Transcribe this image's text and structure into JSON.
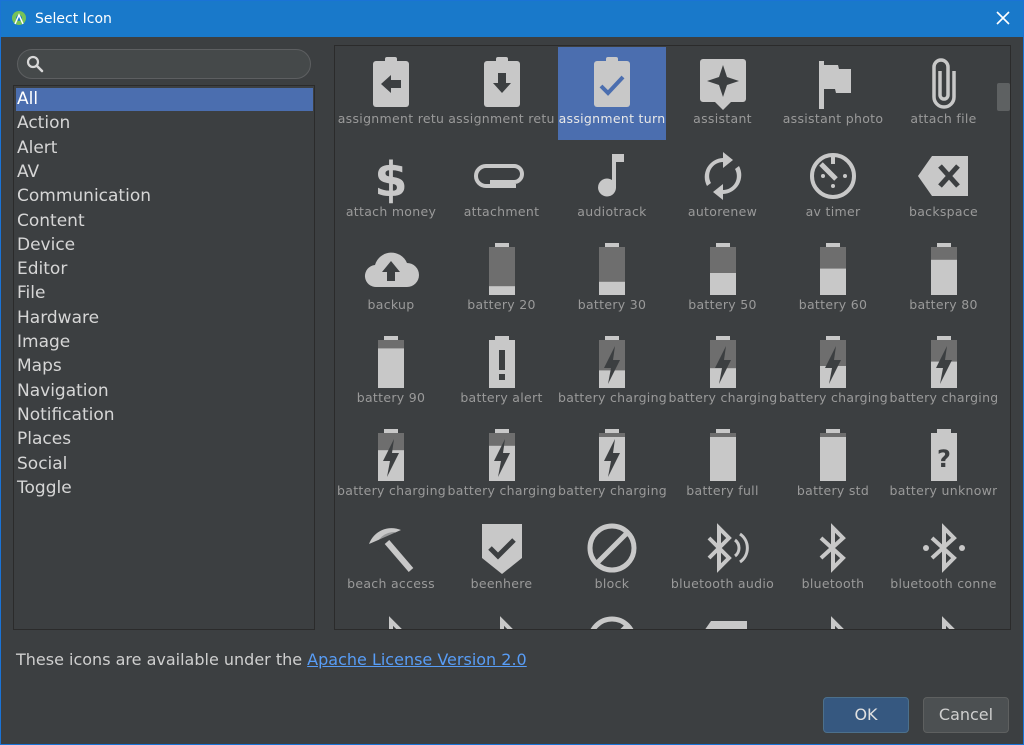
{
  "window": {
    "title": "Select Icon"
  },
  "search": {
    "placeholder": "",
    "value": ""
  },
  "categories": [
    "All",
    "Action",
    "Alert",
    "AV",
    "Communication",
    "Content",
    "Device",
    "Editor",
    "File",
    "Hardware",
    "Image",
    "Maps",
    "Navigation",
    "Notification",
    "Places",
    "Social",
    "Toggle"
  ],
  "selected_category": "All",
  "icons": [
    {
      "label": "assignment retu",
      "icon": "assignment-return-icon"
    },
    {
      "label": "assignment retu",
      "icon": "assignment-returned-icon"
    },
    {
      "label": "assignment turn",
      "icon": "assignment-turned-in-icon",
      "selected": true
    },
    {
      "label": "assistant",
      "icon": "assistant-icon"
    },
    {
      "label": "assistant photo",
      "icon": "assistant-photo-icon"
    },
    {
      "label": "attach file",
      "icon": "attach-file-icon"
    },
    {
      "label": "attach money",
      "icon": "attach-money-icon"
    },
    {
      "label": "attachment",
      "icon": "attachment-icon"
    },
    {
      "label": "audiotrack",
      "icon": "audiotrack-icon"
    },
    {
      "label": "autorenew",
      "icon": "autorenew-icon"
    },
    {
      "label": "av timer",
      "icon": "av-timer-icon"
    },
    {
      "label": "backspace",
      "icon": "backspace-icon"
    },
    {
      "label": "backup",
      "icon": "backup-icon"
    },
    {
      "label": "battery 20",
      "icon": "battery-20-icon"
    },
    {
      "label": "battery 30",
      "icon": "battery-30-icon"
    },
    {
      "label": "battery 50",
      "icon": "battery-50-icon"
    },
    {
      "label": "battery 60",
      "icon": "battery-60-icon"
    },
    {
      "label": "battery 80",
      "icon": "battery-80-icon"
    },
    {
      "label": "battery 90",
      "icon": "battery-90-icon"
    },
    {
      "label": "battery alert",
      "icon": "battery-alert-icon"
    },
    {
      "label": "battery charging",
      "icon": "battery-charging-20-icon"
    },
    {
      "label": "battery charging",
      "icon": "battery-charging-30-icon"
    },
    {
      "label": "battery charging",
      "icon": "battery-charging-50-icon"
    },
    {
      "label": "battery charging",
      "icon": "battery-charging-60-icon"
    },
    {
      "label": "battery charging",
      "icon": "battery-charging-80-icon"
    },
    {
      "label": "battery charging",
      "icon": "battery-charging-90-icon"
    },
    {
      "label": "battery charging",
      "icon": "battery-charging-full-icon"
    },
    {
      "label": "battery full",
      "icon": "battery-full-icon"
    },
    {
      "label": "battery std",
      "icon": "battery-std-icon"
    },
    {
      "label": "battery unknown",
      "icon": "battery-unknown-icon"
    },
    {
      "label": "beach access",
      "icon": "beach-access-icon"
    },
    {
      "label": "beenhere",
      "icon": "beenhere-icon"
    },
    {
      "label": "block",
      "icon": "block-icon"
    },
    {
      "label": "bluetooth audio",
      "icon": "bluetooth-audio-icon"
    },
    {
      "label": "bluetooth",
      "icon": "bluetooth-icon"
    },
    {
      "label": "bluetooth conne",
      "icon": "bluetooth-connected-icon"
    }
  ],
  "footer": {
    "license_prefix": "These icons are available under the ",
    "license_link": "Apache License Version 2.0"
  },
  "buttons": {
    "ok": "OK",
    "cancel": "Cancel"
  },
  "colors": {
    "accent": "#4b6eaf",
    "titlebar": "#1979ca",
    "icon": "#c8c8c8",
    "link": "#589df6"
  }
}
